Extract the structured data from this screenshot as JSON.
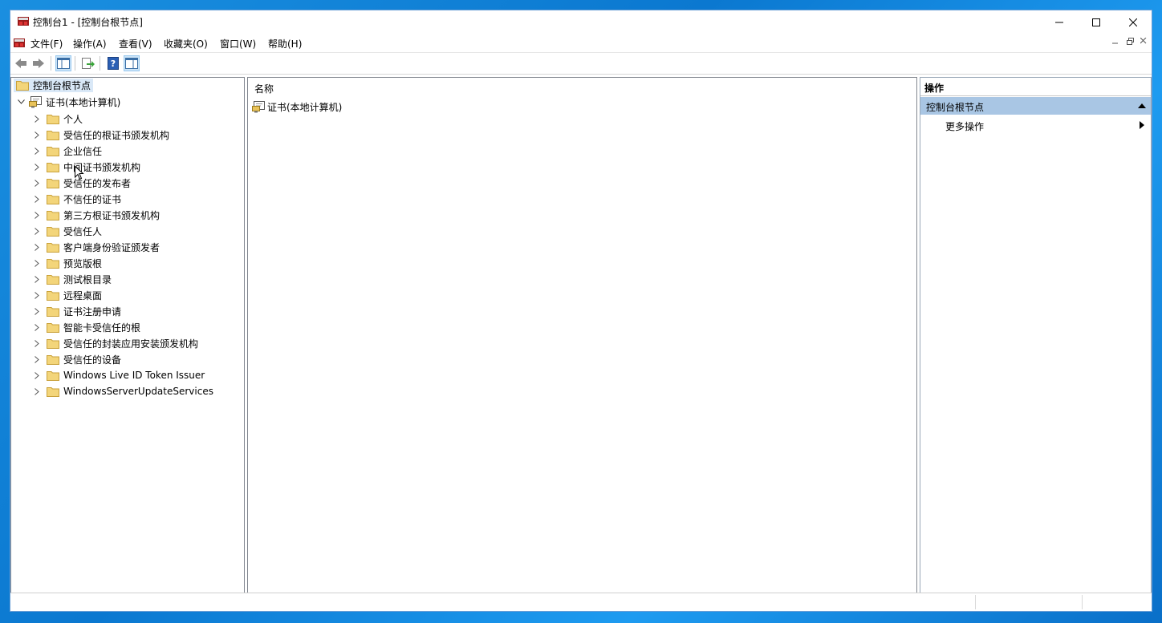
{
  "window": {
    "title": "控制台1 - [控制台根节点]"
  },
  "menu": {
    "items": [
      "文件(F)",
      "操作(A)",
      "查看(V)",
      "收藏夹(O)",
      "窗口(W)",
      "帮助(H)"
    ]
  },
  "toolbar": {
    "buttons": [
      "back-icon",
      "forward-icon",
      "show-hide-tree-icon",
      "export-list-icon",
      "help-icon",
      "show-hide-action-pane-icon"
    ]
  },
  "tree": {
    "root_label": "控制台根节点",
    "snapin_label": "证书(本地计算机)",
    "children": [
      "个人",
      "受信任的根证书颁发机构",
      "企业信任",
      "中间证书颁发机构",
      "受信任的发布者",
      "不信任的证书",
      "第三方根证书颁发机构",
      "受信任人",
      "客户端身份验证颁发者",
      "预览版根",
      "测试根目录",
      "远程桌面",
      "证书注册申请",
      "智能卡受信任的根",
      "受信任的封装应用安装颁发机构",
      "受信任的设备",
      "Windows Live ID Token Issuer",
      "WindowsServerUpdateServices"
    ]
  },
  "list": {
    "column_name": "名称",
    "items": [
      "证书(本地计算机)"
    ]
  },
  "actions": {
    "header": "操作",
    "section_title": "控制台根节点",
    "more_actions": "更多操作"
  },
  "colors": {
    "desktop": "#0b78d0",
    "selection": "#d9e8f7",
    "action_section": "#a9c6e4",
    "folder": "#e8c25a"
  }
}
